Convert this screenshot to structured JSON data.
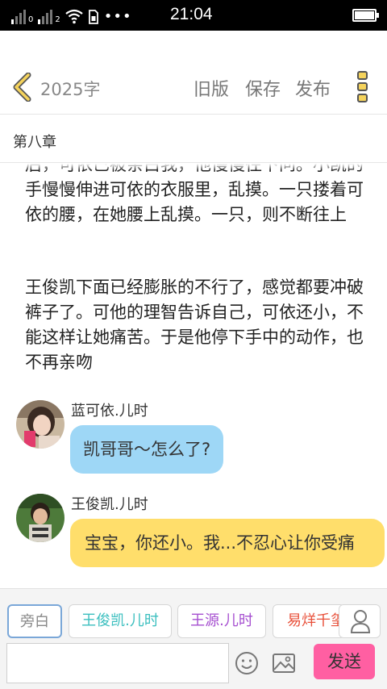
{
  "status_bar": {
    "time": "21:04",
    "sim1_label": "0",
    "sim2_label": "2",
    "more_dots": "•••"
  },
  "header": {
    "word_count": "2025字",
    "old_version": "旧版",
    "save": "保存",
    "publish": "发布"
  },
  "chapter": {
    "title": "第八章"
  },
  "content": {
    "paragraph1": "后，可依已被亲白我，他慢慢往下问。小凯的手慢慢伸进可依的衣服里，乱摸。一只搂着可依的腰，在她腰上乱摸。一只，则不断往上",
    "paragraph2": "王俊凯下面已经膨胀的不行了，感觉都要冲破裤子了。可他的理智告诉自己，可依还小，不能这样让她痛苦。于是他停下手中的动作，也不再亲吻",
    "messages": [
      {
        "name": "蓝可依.儿时",
        "text": "凯哥哥～怎么了?"
      },
      {
        "name": "王俊凯.儿时",
        "text": "宝宝，你还小。我...不忍心让你受痛"
      }
    ]
  },
  "characters": [
    {
      "label": "旁白",
      "color": "#888888"
    },
    {
      "label": "王俊凯.儿时",
      "color": "#3bbfbf"
    },
    {
      "label": "王源.儿时",
      "color": "#a64fd0"
    },
    {
      "label": "易烊千玺",
      "color": "#e8503a"
    }
  ],
  "composer": {
    "input_value": "",
    "send_label": "发送"
  },
  "colors": {
    "accent_yellow": "#f5d35c",
    "bubble_blue": "#9ed7f6",
    "bubble_yellow": "#ffde6b",
    "send_pink": "#ff5fa2"
  }
}
